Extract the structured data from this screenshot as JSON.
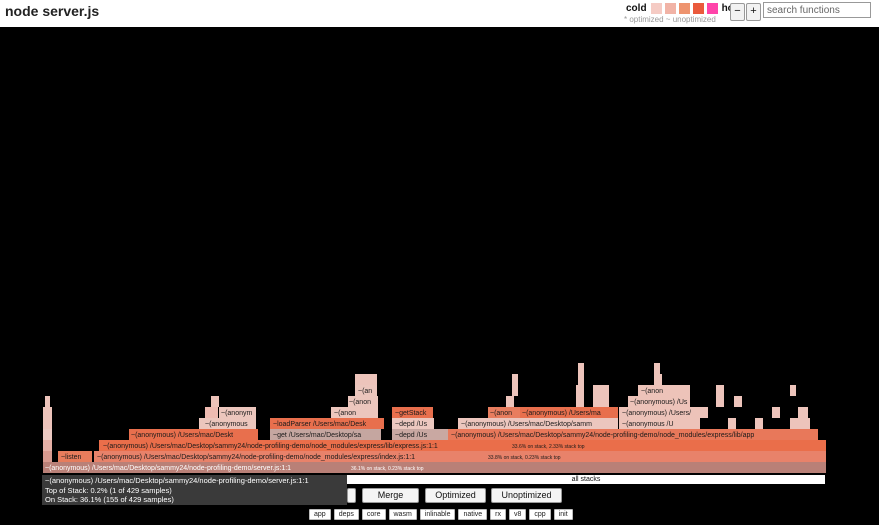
{
  "header": {
    "title": "node server.js",
    "legend_cold": "cold",
    "legend_hot": "hot",
    "legend_swatches": [
      "#f5cbc4",
      "#f1b3a6",
      "#ee946f",
      "#ea5a3c",
      "#ff44aa"
    ],
    "legend_note": "* optimized ~ unoptimized",
    "zoom_out": "−",
    "zoom_in": "+",
    "search_placeholder": "search functions"
  },
  "flamegraph": {
    "frames": {
      "server": "~(anonymous) /Users/mac/Desktop/sammy24/node-profiling-demo/server.js:1:1",
      "server_stats": "36.1% on stack, 0.23% stack top",
      "listen": "~listen",
      "express_index": "~(anonymous) /Users/mac/Desktop/sammy24/node-profiling-demo/node_modules/express/index.js:1:1",
      "express_index_stats": "33.8% on stack, 0.23% stack top",
      "anon_deskt": "~(anonymous) /Users/mac/Deskt",
      "express_lib": "~(anonymous) /Users/mac/Desktop/sammy24/node-profiling-demo/node_modules/express/lib/express.js:1:1",
      "express_lib_stats": "33.6% on stack, 2.33% stack top",
      "anonymous_short": "~(anonymous",
      "get_sa": "~get /Users/mac/Desktop/sa",
      "depd_us": "~depd /Us",
      "anon_sam": "~(anonymous) /Users/mac/Desktop/samm",
      "express_lib_app": "~(anonymous) /Users/mac/Desktop/sammy24/node-profiling-demo/node_modules/express/lib/app",
      "loadparser": "~loadParser /Users/mac/Desk",
      "anon_users": "~(anon",
      "getstack": "~getStack",
      "anon_users_ma": "~(anonymous) /Users/ma",
      "anon_users2": "~(anonymous) /Users/",
      "anon_u": "~(anonymous /U",
      "anon_small": "~(anon"
    }
  },
  "tooltip": {
    "line1": "~(anonymous) /Users/mac/Desktop/sammy24/node-profiling-demo/server.js:1:1",
    "line2": "Top of Stack: 0.2% (1 of 429 samples)",
    "line3": "On Stack: 36.1% (155 of 429 samples)"
  },
  "all_stacks": "all stacks",
  "controls": {
    "merge": "Merge",
    "optimized": "Optimized",
    "unoptimized": "Unoptimized"
  },
  "tags": [
    "app",
    "deps",
    "core",
    "wasm",
    "inlinable",
    "native",
    "rx",
    "v8",
    "cpp",
    "init"
  ]
}
